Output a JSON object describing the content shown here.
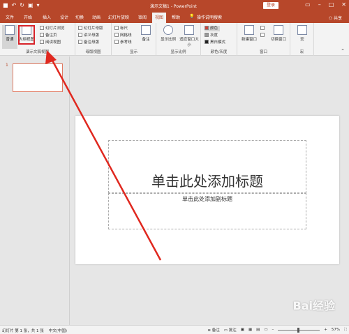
{
  "titlebar": {
    "title": "演示文稿1 - PowerPoint",
    "login": "登录"
  },
  "tabs": [
    "文件",
    "开始",
    "插入",
    "设计",
    "切换",
    "动画",
    "幻灯片放映",
    "审阅",
    "视图",
    "帮助",
    "操作说明搜索"
  ],
  "active_tab": "视图",
  "share": "共享",
  "ribbon": {
    "groups": {
      "presentation_views": {
        "label": "演示文稿视图",
        "normal": "普通",
        "outline": "大纲视图",
        "slide_sorter": "幻灯片浏览",
        "notes_page": "备注页",
        "reading_view": "阅读视图"
      },
      "master_views": {
        "label": "母版视图",
        "slide_master": "幻灯片母版",
        "handout_master": "讲义母版",
        "notes_master": "备注母版"
      },
      "show": {
        "label": "显示",
        "ruler": "标尺",
        "gridlines": "网格线",
        "guides": "参考线",
        "notes": "备注"
      },
      "zoom": {
        "label": "显示比例",
        "zoom": "显示比例",
        "fit": "适应窗口大小"
      },
      "color": {
        "label": "颜色/灰度",
        "color": "颜色",
        "grayscale": "灰度",
        "bw": "黑白模式"
      },
      "window": {
        "label": "窗口",
        "new_window": "新建窗口",
        "switch": "切换窗口"
      },
      "macros": {
        "label": "宏",
        "macros": "宏"
      }
    }
  },
  "thumbnail": {
    "number": "1"
  },
  "slide": {
    "title_placeholder": "单击此处添加标题",
    "subtitle_placeholder": "单击此处添加副标题"
  },
  "status": {
    "slide_info": "幻灯片 第 1 张，共 1 张",
    "language": "中文(中国)",
    "notes": "备注",
    "comments": "批注",
    "zoom": "57%"
  },
  "watermark": "Bai经验",
  "colors": {
    "brand": "#b7472a",
    "highlight": "#d8232a"
  }
}
